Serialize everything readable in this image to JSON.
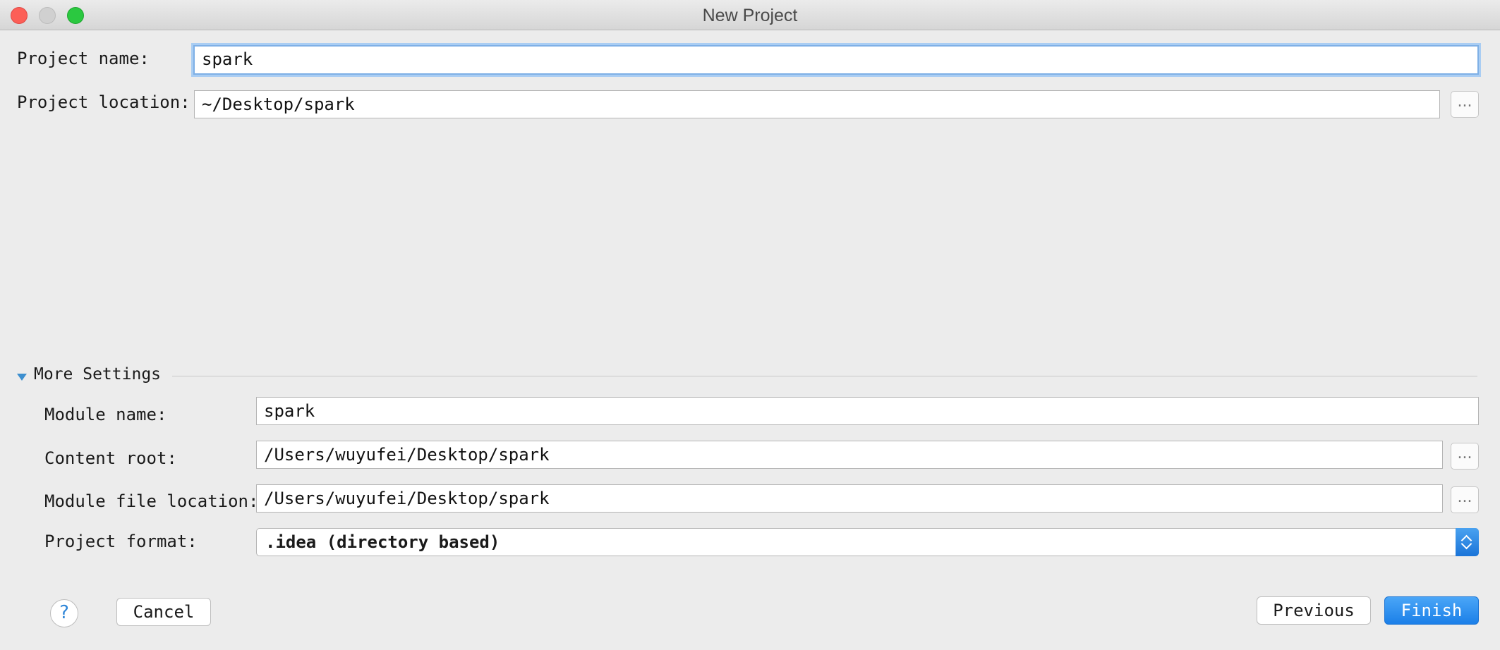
{
  "window": {
    "title": "New Project"
  },
  "form": {
    "project_name_label": "Project name:",
    "project_name_value": "spark",
    "project_location_label": "Project location:",
    "project_location_value": "~/Desktop/spark",
    "browse_label": "..."
  },
  "more_settings": {
    "label": "More Settings",
    "expanded": true,
    "module_name_label": "Module name:",
    "module_name_value": "spark",
    "content_root_label": "Content root:",
    "content_root_value": "/Users/wuyufei/Desktop/spark",
    "module_file_location_label": "Module file location:",
    "module_file_location_value": "/Users/wuyufei/Desktop/spark",
    "project_format_label": "Project format:",
    "project_format_value": ".idea (directory based)"
  },
  "footer": {
    "help_label": "?",
    "cancel_label": "Cancel",
    "previous_label": "Previous",
    "finish_label": "Finish"
  },
  "colors": {
    "accent": "#1b7fe8",
    "focus_ring": "#a9cdf3",
    "close": "#fc5f57",
    "maximize": "#2bc840"
  }
}
